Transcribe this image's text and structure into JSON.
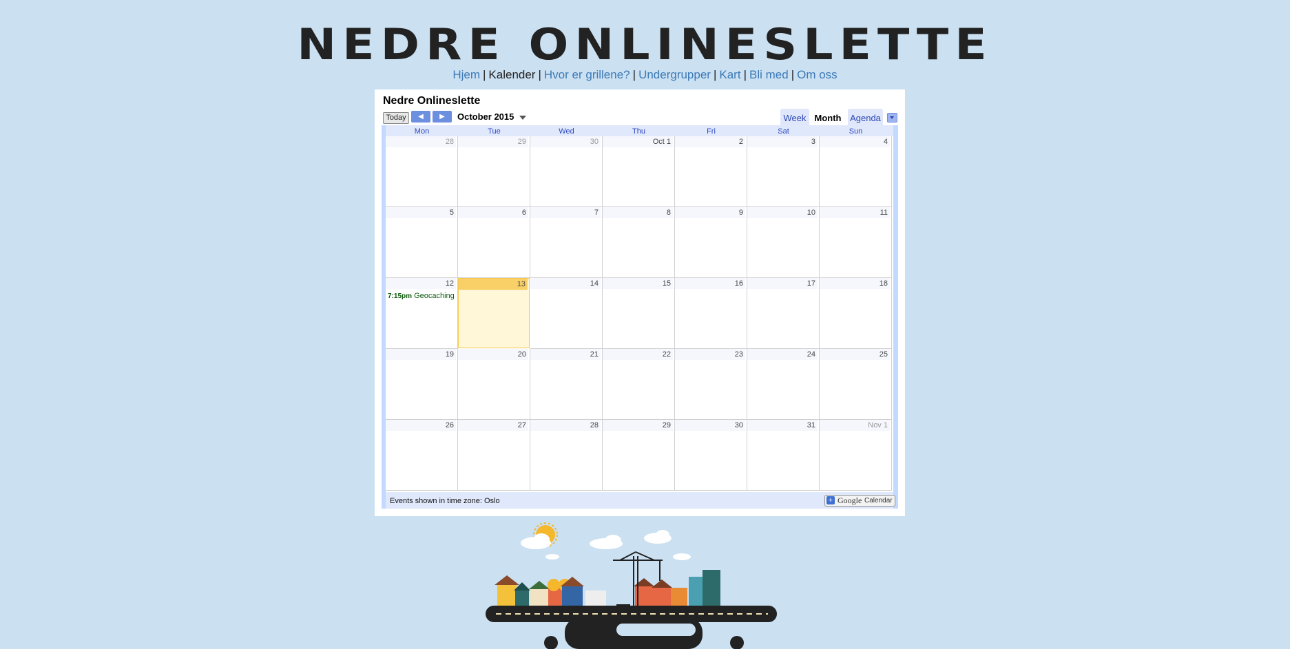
{
  "site": {
    "title": "NEDRE ONLINESLETTE"
  },
  "nav": {
    "items": [
      {
        "label": "Hjem",
        "current": false
      },
      {
        "label": "Kalender",
        "current": true
      },
      {
        "label": "Hvor er grillene?",
        "current": false
      },
      {
        "label": "Undergrupper",
        "current": false
      },
      {
        "label": "Kart",
        "current": false
      },
      {
        "label": "Bli med",
        "current": false
      },
      {
        "label": "Om oss",
        "current": false
      }
    ],
    "separator": "|"
  },
  "calendar": {
    "title": "Nedre Onlineslette",
    "today_label": "Today",
    "month_label": "October 2015",
    "views": {
      "week": "Week",
      "month": "Month",
      "agenda": "Agenda"
    },
    "days_of_week": [
      "Mon",
      "Tue",
      "Wed",
      "Thu",
      "Fri",
      "Sat",
      "Sun"
    ],
    "weeks": [
      [
        {
          "d": "28",
          "other": true
        },
        {
          "d": "29",
          "other": true
        },
        {
          "d": "30",
          "other": true
        },
        {
          "d": "Oct 1"
        },
        {
          "d": "2"
        },
        {
          "d": "3"
        },
        {
          "d": "4"
        }
      ],
      [
        {
          "d": "5"
        },
        {
          "d": "6"
        },
        {
          "d": "7"
        },
        {
          "d": "8"
        },
        {
          "d": "9"
        },
        {
          "d": "10"
        },
        {
          "d": "11"
        }
      ],
      [
        {
          "d": "12",
          "event": {
            "time": "7:15pm",
            "title": "Geocaching"
          }
        },
        {
          "d": "13",
          "today": true
        },
        {
          "d": "14"
        },
        {
          "d": "15"
        },
        {
          "d": "16"
        },
        {
          "d": "17"
        },
        {
          "d": "18"
        }
      ],
      [
        {
          "d": "19"
        },
        {
          "d": "20"
        },
        {
          "d": "21"
        },
        {
          "d": "22"
        },
        {
          "d": "23"
        },
        {
          "d": "24"
        },
        {
          "d": "25"
        }
      ],
      [
        {
          "d": "26"
        },
        {
          "d": "27"
        },
        {
          "d": "28"
        },
        {
          "d": "29"
        },
        {
          "d": "30"
        },
        {
          "d": "31"
        },
        {
          "d": "Nov 1",
          "other": true
        }
      ]
    ],
    "timezone_note": "Events shown in time zone: Oslo",
    "badge": {
      "google": "Google",
      "calendar": "Calendar",
      "plus": "+"
    }
  },
  "colors": {
    "background": "#cbe0f1",
    "link": "#3d7ab7",
    "today_fill": "#fff7d7",
    "event_text": "#0d5c0d"
  }
}
